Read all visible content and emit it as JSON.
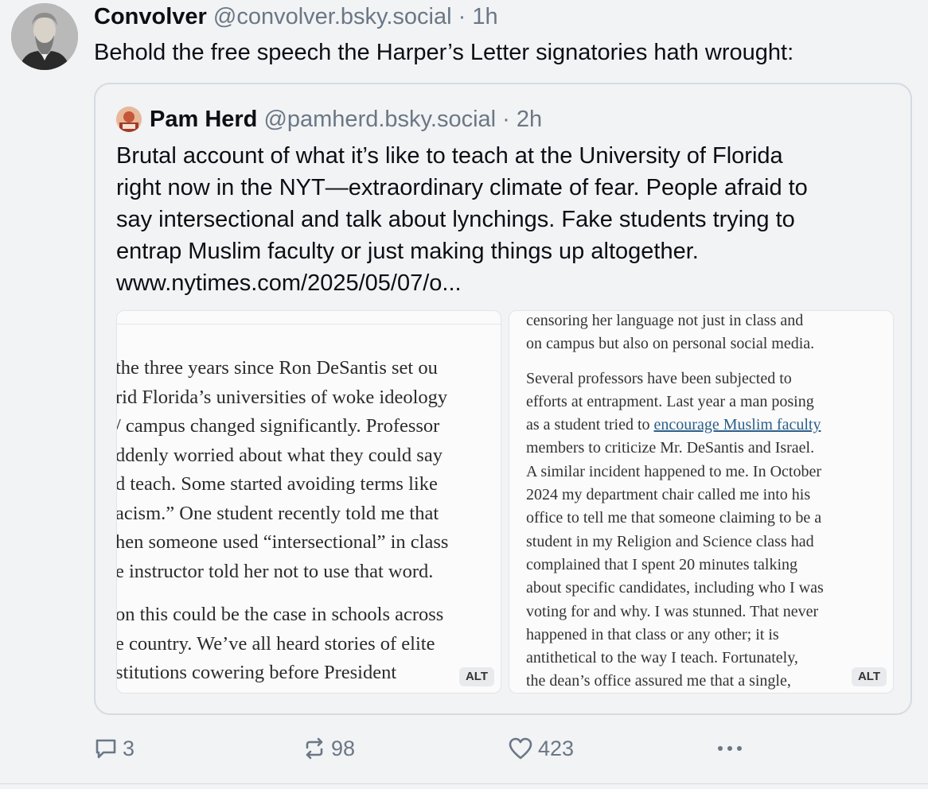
{
  "post": {
    "author_name": "Convolver",
    "author_handle": "@convolver.bsky.social",
    "separator": "·",
    "time": "1h",
    "text": "Behold the free speech the Harper’s Letter signatories hath wrought:"
  },
  "quote": {
    "author_name": "Pam Herd",
    "author_handle": "@pamherd.bsky.social",
    "separator": "·",
    "time": "2h",
    "lines": [
      "Brutal account of what it’s like to teach at the University of Florida",
      "right now in the NYT—extraordinary climate of fear.  People afraid to",
      "say intersectional and talk about lynchings. Fake students trying to",
      "entrap Muslim faculty or just making things up altogether.",
      "www.nytimes.com/2025/05/07/o..."
    ]
  },
  "image1": {
    "para1": [
      "the three years since Ron DeSantis set ou",
      "rid Florida’s universities of woke ideology",
      "/ campus changed significantly. Professor",
      "ddenly worried about what they could say",
      "d teach. Some started avoiding terms like",
      "acism.” One student recently told me that",
      "hen someone used “intersectional” in class",
      "e instructor told her not to use that word."
    ],
    "para2": [
      "on this could be the case in schools across",
      "e country. We’ve all heard stories of elite",
      "stitutions cowering before President"
    ],
    "alt_label": "ALT"
  },
  "image2": {
    "para1": [
      "censoring her language not just in class and",
      "on campus but also on personal social media."
    ],
    "para2_line1": "Several professors have been subjected to",
    "para2_line2": "efforts at entrapment. Last year a man posing",
    "para2_line3_pre": "as a student tried to ",
    "para2_line3_link": "encourage Muslim faculty",
    "para2_rest": [
      "members to criticize Mr. DeSantis and Israel.",
      "A similar incident happened to me. In October",
      "2024 my department chair called me into his",
      "office to tell me that someone claiming to be a",
      "student in my Religion and Science class had",
      "complained that I spent 20 minutes talking",
      "about specific candidates, including who I was",
      "voting for and why. I was stunned. That never",
      "happened in that class or any other; it is",
      "antithetical to the way I teach. Fortunately,",
      "the dean’s office assured me that a single,"
    ],
    "alt_label": "ALT"
  },
  "actions": {
    "reply_count": "3",
    "repost_count": "98",
    "like_count": "423",
    "more_icon": "ellipsis-icon"
  },
  "colors": {
    "background": "#f1f3f5",
    "muted": "#6b7785",
    "border": "#d5dbe2",
    "link": "#2c5f8a"
  }
}
